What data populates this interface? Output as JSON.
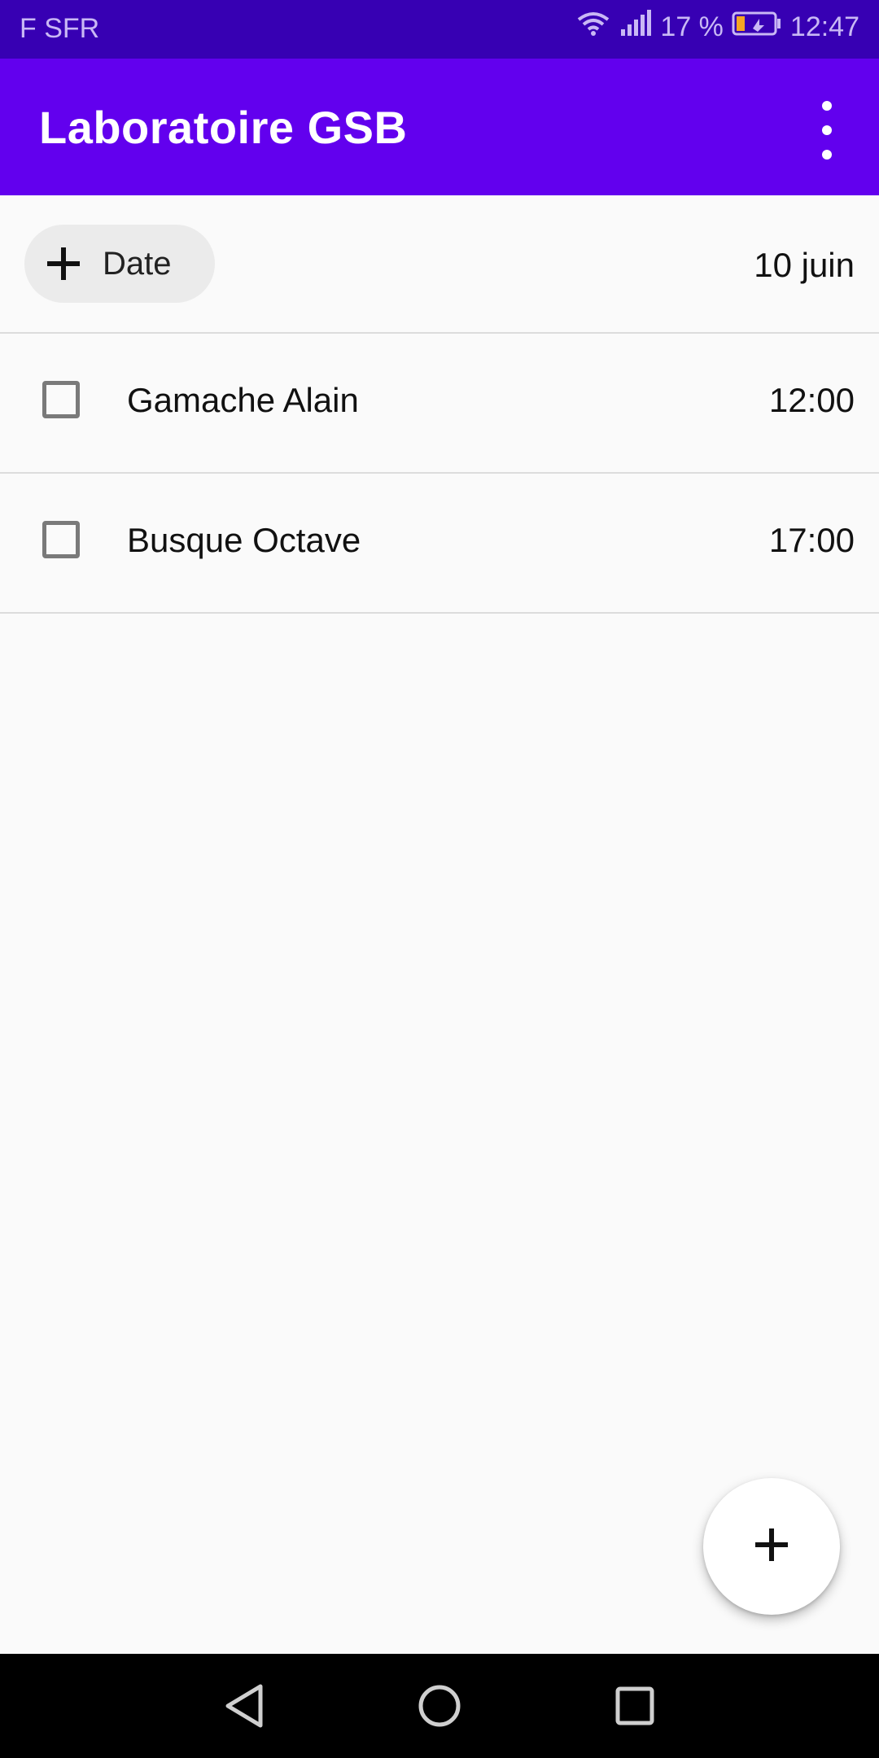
{
  "status_bar": {
    "carrier": "F SFR",
    "battery": "17 %",
    "time": "12:47"
  },
  "app_bar": {
    "title": "Laboratoire GSB",
    "menu_icon": "more-vert-icon"
  },
  "filter": {
    "chip_label": "Date",
    "chip_icon": "plus-icon",
    "selected_date": "10 juin"
  },
  "appointments": [
    {
      "name": "Gamache Alain",
      "time": "12:00",
      "checked": false
    },
    {
      "name": "Busque Octave",
      "time": "17:00",
      "checked": false
    }
  ],
  "fab": {
    "icon": "plus-icon"
  },
  "colors": {
    "status_bar": "#3700b3",
    "app_bar": "#6200ee",
    "background": "#fafafa"
  }
}
